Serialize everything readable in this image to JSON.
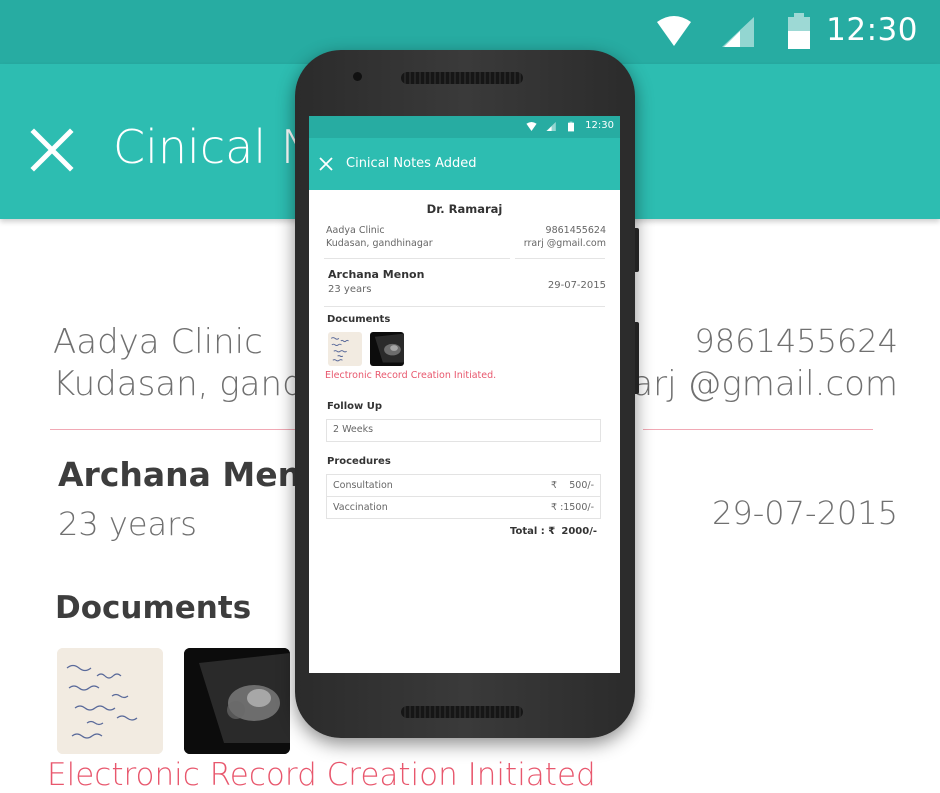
{
  "status_bar": {
    "time": "12:30"
  },
  "app_bar": {
    "title": "Cinical Notes Added",
    "title_visible_bg": "Cinical No"
  },
  "doctor": {
    "name": "Dr. Ramaraj"
  },
  "clinic": {
    "name": "Aadya Clinic",
    "address": "Kudasan, gandhinagar",
    "address_visible_bg": "Kudasan, gandh",
    "phone": "9861455624",
    "email": "rrarj @gmail.com"
  },
  "patient": {
    "name": "Archana Menon",
    "name_visible_bg": "Archana Meno",
    "age": "23 years",
    "date": "29-07-2015"
  },
  "documents": {
    "heading": "Documents",
    "status": "Electronic Record Creation Initiated.",
    "status_visible_bg": "Electronic Record Creation Initiated",
    "items": [
      "handwritten-note-thumbnail",
      "ultrasound-scan-thumbnail"
    ]
  },
  "follow_up": {
    "heading": "Follow Up",
    "value": "2 Weeks"
  },
  "procedures": {
    "heading": "Procedures",
    "items": [
      {
        "name": "Consultation",
        "currency": "₹",
        "amount": "500/-"
      },
      {
        "name": "Vaccination",
        "currency": "₹ :",
        "amount": "1500/-"
      }
    ],
    "total_label": "Total : ₹",
    "total_amount": "2000/-"
  },
  "colors": {
    "teal": "#2dbdb1",
    "teal_dark": "#27aca2",
    "accent_red": "#e8576d",
    "divider": "#f1a9b5"
  },
  "icons": [
    "wifi-icon",
    "cell-signal-icon",
    "battery-icon",
    "close-icon"
  ]
}
